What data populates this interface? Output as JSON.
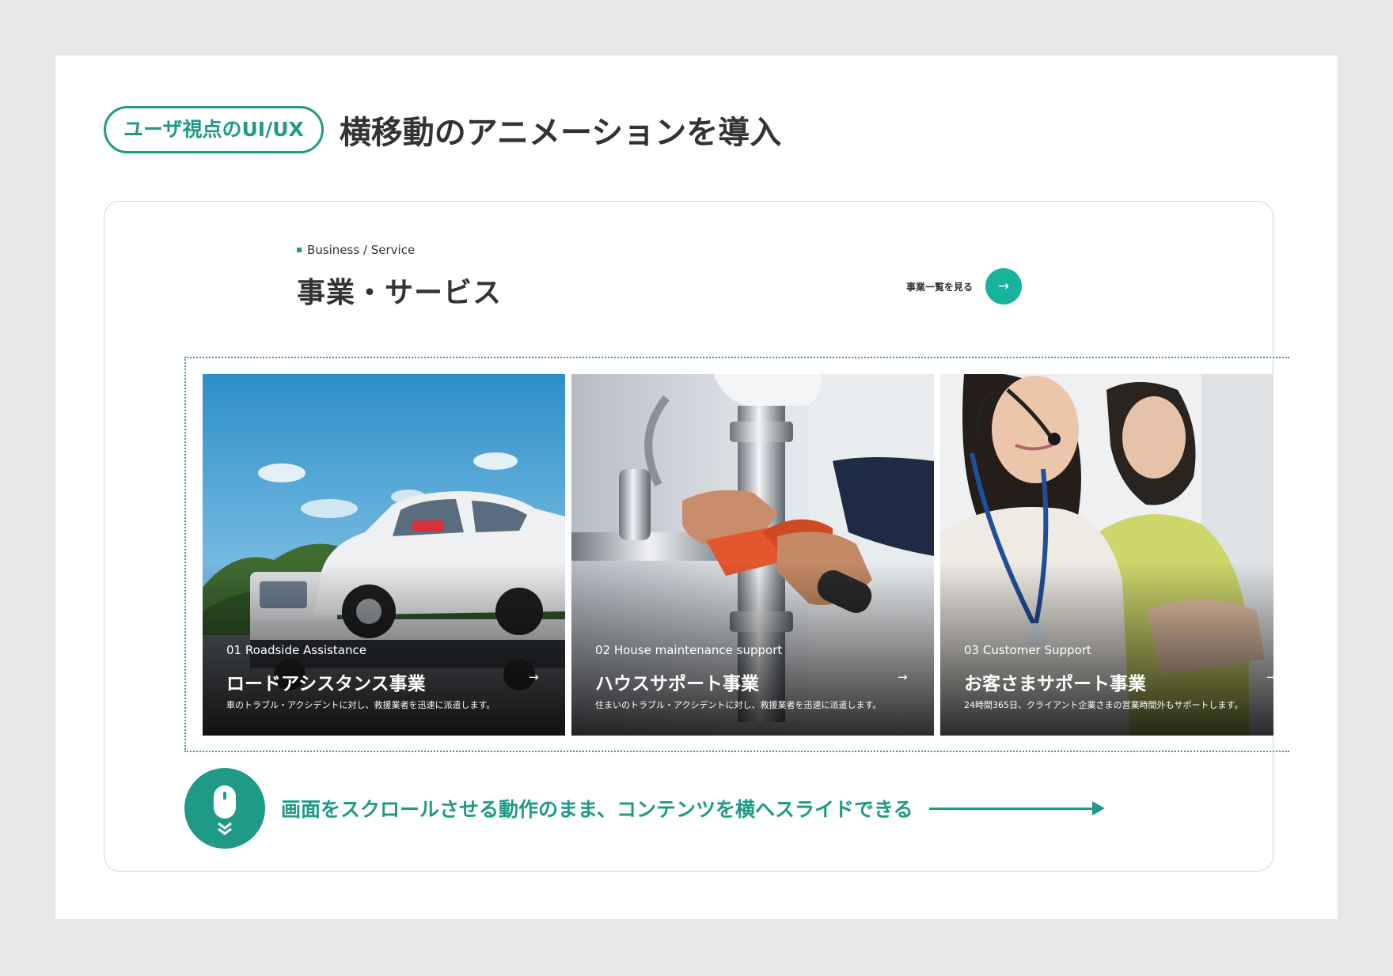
{
  "header": {
    "pill_label": "ユーザ視点のUI/UX",
    "title": "横移動のアニメーションを導入"
  },
  "section": {
    "eyebrow": "Business / Service",
    "title": "事業・サービス",
    "see_all_label": "事業一覧を見る",
    "see_all_icon": "arrow-right-icon"
  },
  "cards": [
    {
      "num": "01 Roadside Assistance",
      "title": "ロードアシスタンス事業",
      "desc": "車のトラブル・アクシデントに対し、救援業者を迅速に派遣します。",
      "arrow": "→"
    },
    {
      "num": "02 House maintenance support",
      "title": "ハウスサポート事業",
      "desc": "住まいのトラブル・アクシデントに対し、救援業者を迅速に派遣します。",
      "arrow": "→"
    },
    {
      "num": "03 Customer Support",
      "title": "お客さまサポート事業",
      "desc": "24時間365日、クライアント企業さまの営業時間外もサポートします。",
      "arrow": "→"
    }
  ],
  "note": {
    "text": "画面をスクロールさせる動作のまま、コンテンツを横へスライドできる",
    "icon": "mouse-scroll-icon"
  },
  "colors": {
    "accent": "#1e9a86",
    "button": "#17b39c"
  }
}
